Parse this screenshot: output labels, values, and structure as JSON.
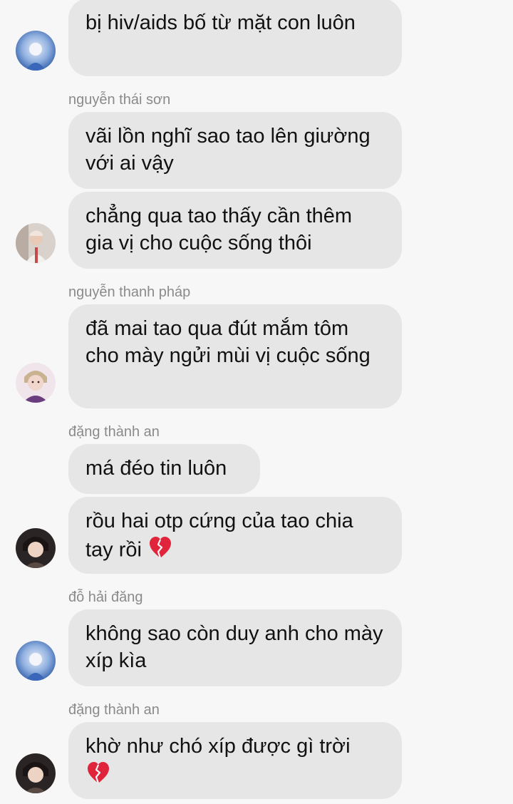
{
  "messages": [
    {
      "text": "bị hiv/aids bố từ mặt con luôn"
    },
    {
      "sender": "nguyễn thái sơn",
      "text": "vãi lồn nghĩ sao tao lên giường với ai vậy"
    },
    {
      "text": "chẳng qua tao thấy cần thêm gia vị cho cuộc sống thôi"
    },
    {
      "sender": "nguyễn thanh pháp",
      "text": "đã mai tao qua đút mắm tôm cho mày ngửi mùi vị cuộc sống"
    },
    {
      "sender": "đặng thành an",
      "text": "má đéo tin luôn"
    },
    {
      "text": "rồu hai otp cứng của tao chia tay rồi"
    },
    {
      "sender": "đỗ hải đăng",
      "text": "không sao còn duy anh cho mày xíp kìa"
    },
    {
      "sender": "đặng thành an",
      "text": "khờ như chó xíp được gì trời"
    }
  ],
  "icons": {
    "broken_heart": "broken-heart-emoji"
  },
  "colors": {
    "background": "#f7f7f7",
    "bubble": "#e6e6e6",
    "sender_name": "#8a8a8a",
    "broken_heart": "#e0243c"
  }
}
